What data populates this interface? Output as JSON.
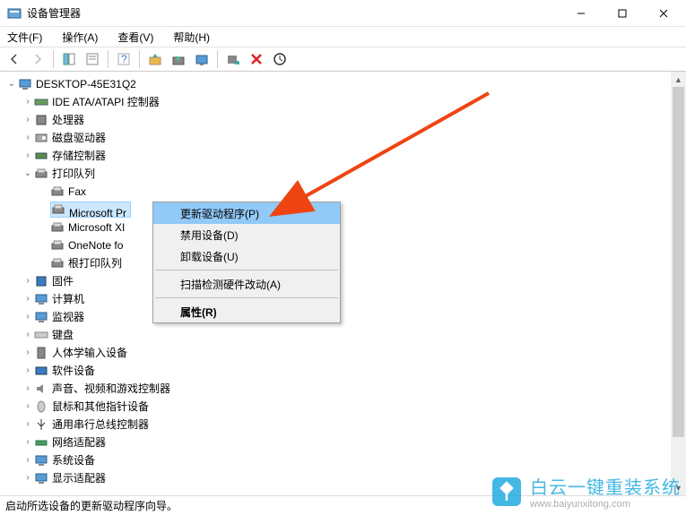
{
  "window": {
    "title": "设备管理器"
  },
  "menu": {
    "file": "文件(F)",
    "action": "操作(A)",
    "view": "查看(V)",
    "help": "帮助(H)"
  },
  "tree": {
    "root": "DESKTOP-45E31Q2",
    "items": [
      {
        "label": "IDE ATA/ATAPI 控制器",
        "expanded": false
      },
      {
        "label": "处理器",
        "expanded": false
      },
      {
        "label": "磁盘驱动器",
        "expanded": false
      },
      {
        "label": "存储控制器",
        "expanded": false
      },
      {
        "label": "打印队列",
        "expanded": true,
        "children": [
          {
            "label": "Fax"
          },
          {
            "label": "Microsoft Pr",
            "selected": true
          },
          {
            "label": "Microsoft XI"
          },
          {
            "label": "OneNote fo"
          },
          {
            "label": "根打印队列"
          }
        ]
      },
      {
        "label": "固件",
        "expanded": false
      },
      {
        "label": "计算机",
        "expanded": false
      },
      {
        "label": "监视器",
        "expanded": false
      },
      {
        "label": "键盘",
        "expanded": false
      },
      {
        "label": "人体学输入设备",
        "expanded": false
      },
      {
        "label": "软件设备",
        "expanded": false
      },
      {
        "label": "声音、视频和游戏控制器",
        "expanded": false
      },
      {
        "label": "鼠标和其他指针设备",
        "expanded": false
      },
      {
        "label": "通用串行总线控制器",
        "expanded": false
      },
      {
        "label": "网络适配器",
        "expanded": false
      },
      {
        "label": "系统设备",
        "expanded": false
      },
      {
        "label": "显示适配器",
        "expanded": false
      }
    ]
  },
  "context_menu": {
    "update": "更新驱动程序(P)",
    "disable": "禁用设备(D)",
    "uninstall": "卸载设备(U)",
    "scan": "扫描检测硬件改动(A)",
    "properties": "属性(R)"
  },
  "status": "启动所选设备的更新驱动程序向导。",
  "watermark": {
    "brand": "白云一键重装系统",
    "site": "www.baiyunxitong.com"
  }
}
